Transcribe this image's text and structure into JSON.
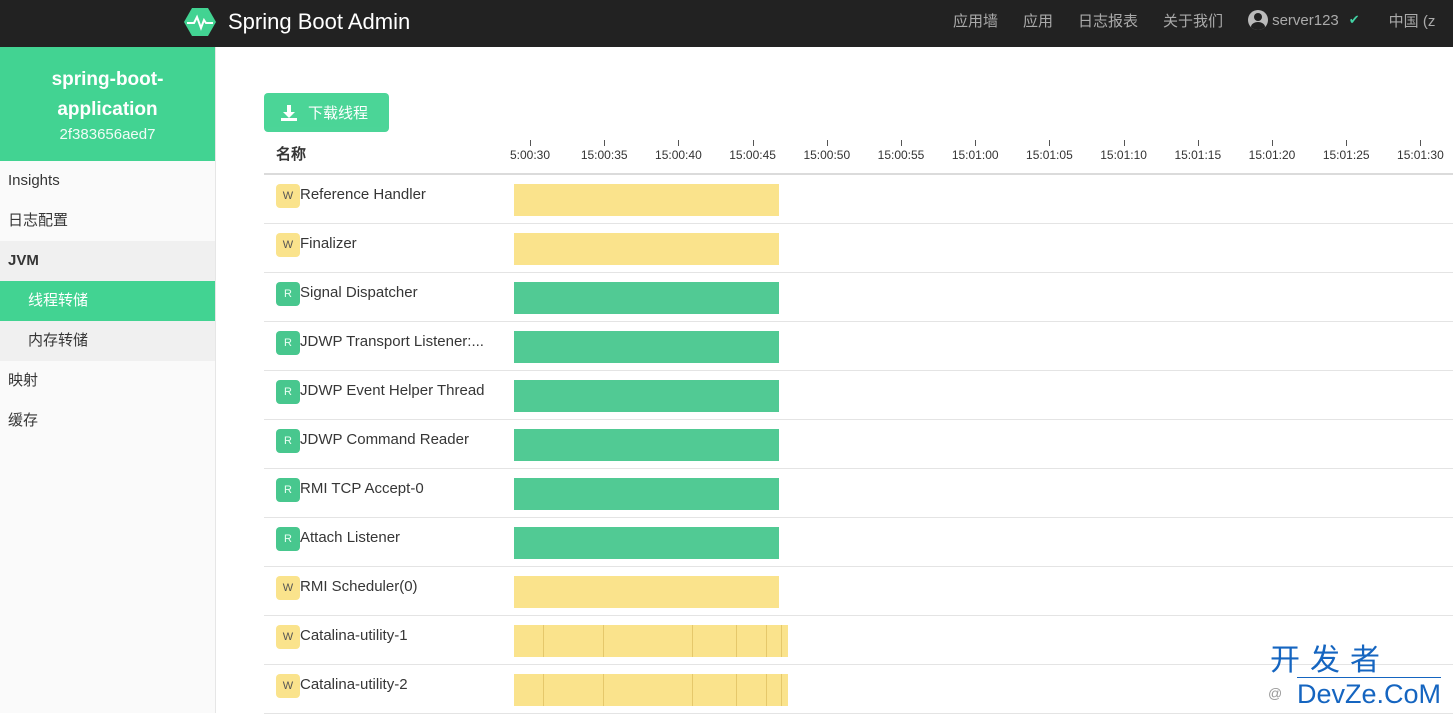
{
  "navbar": {
    "brand_title": "Spring Boot Admin",
    "brand_icon": "heartbeat-hexagon-icon",
    "items": [
      "应用墙",
      "应用",
      "日志报表",
      "关于我们"
    ],
    "user": "server123",
    "language": "中国 (z"
  },
  "sidebar": {
    "app_name_line1": "spring-boot-",
    "app_name_line2": "application",
    "app_id": "2f383656aed7",
    "menu": [
      {
        "label": "Insights",
        "type": "item"
      },
      {
        "label": "日志配置",
        "type": "item"
      },
      {
        "label": "JVM",
        "type": "group"
      },
      {
        "label": "线程转储",
        "type": "sub",
        "active": true
      },
      {
        "label": "内存转储",
        "type": "sub"
      },
      {
        "label": "映射",
        "type": "item"
      },
      {
        "label": "缓存",
        "type": "item"
      }
    ]
  },
  "main": {
    "download_button": "下载线程",
    "column_name": "名称",
    "timeline": {
      "ticks": [
        "5:00:30",
        "15:00:35",
        "15:00:40",
        "15:00:45",
        "15:00:50",
        "15:00:55",
        "15:01:00",
        "15:01:05",
        "15:01:10",
        "15:01:15",
        "15:01:20",
        "15:01:25",
        "15:01:30"
      ],
      "tick_seconds": [
        30,
        35,
        40,
        45,
        50,
        55,
        60,
        65,
        70,
        75,
        80,
        85,
        90
      ],
      "range_seconds": [
        29,
        90
      ],
      "time_base": "15:00:00"
    },
    "threads": [
      {
        "state": "W",
        "name": "Reference Handler",
        "start": 28.9,
        "end": 46.8,
        "segments": []
      },
      {
        "state": "W",
        "name": "Finalizer",
        "start": 28.9,
        "end": 46.8,
        "segments": []
      },
      {
        "state": "R",
        "name": "Signal Dispatcher",
        "start": 28.9,
        "end": 46.8,
        "segments": []
      },
      {
        "state": "R",
        "name": "JDWP Transport Listener:...",
        "start": 28.9,
        "end": 46.8,
        "segments": []
      },
      {
        "state": "R",
        "name": "JDWP Event Helper Thread",
        "start": 28.9,
        "end": 46.8,
        "segments": []
      },
      {
        "state": "R",
        "name": "JDWP Command Reader",
        "start": 28.9,
        "end": 46.8,
        "segments": []
      },
      {
        "state": "R",
        "name": "RMI TCP Accept-0",
        "start": 28.9,
        "end": 46.8,
        "segments": []
      },
      {
        "state": "R",
        "name": "Attach Listener",
        "start": 28.9,
        "end": 46.8,
        "segments": []
      },
      {
        "state": "W",
        "name": "RMI Scheduler(0)",
        "start": 28.9,
        "end": 46.8,
        "segments": []
      },
      {
        "state": "W",
        "name": "Catalina-utility-1",
        "start": 28.9,
        "end": 47.4,
        "segments": [
          30.9,
          34.9,
          40.9,
          43.9,
          45.9,
          46.9
        ]
      },
      {
        "state": "W",
        "name": "Catalina-utility-2",
        "start": 28.9,
        "end": 47.4,
        "segments": [
          30.9,
          34.9,
          40.9,
          43.9,
          45.9,
          46.9
        ]
      }
    ]
  },
  "colors": {
    "accent": "#42d392",
    "waiting": "#fae38c",
    "running": "#48c78e",
    "navbar": "#222222"
  },
  "watermark": {
    "line1": "开发者",
    "line2": "DevZe.CoM",
    "at": "@"
  }
}
